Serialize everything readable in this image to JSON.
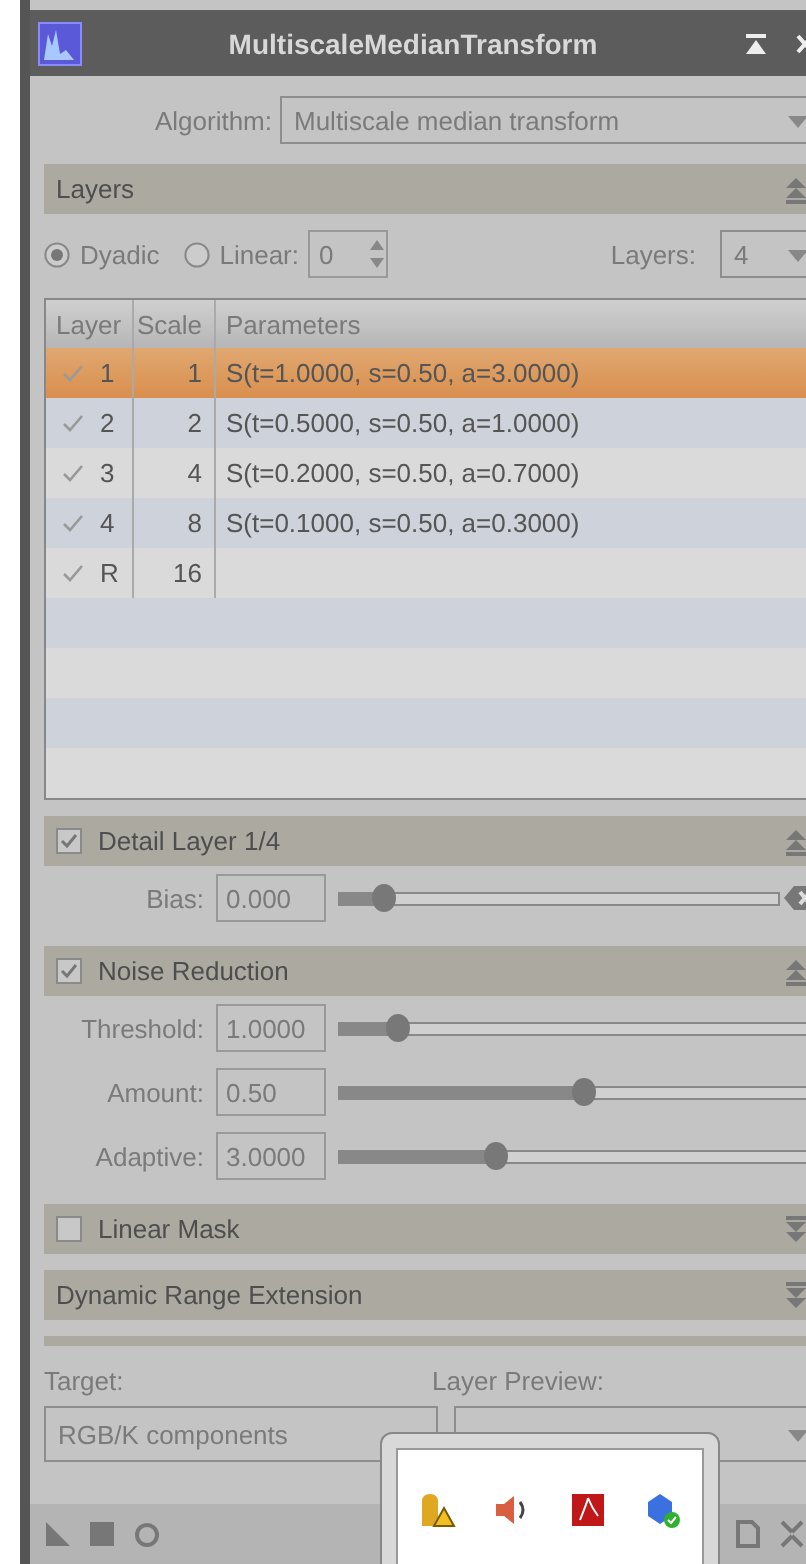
{
  "window": {
    "title": "MultiscaleMedianTransform"
  },
  "algorithm": {
    "label": "Algorithm:",
    "value": "Multiscale median transform"
  },
  "sections": [
    {
      "kind": "layers",
      "title": "Layers",
      "expanded": true,
      "scaling": [
        {
          "label": "Dyadic",
          "selected": true
        },
        {
          "label": "Linear:",
          "selected": false
        }
      ],
      "linear_value": "0",
      "count_label": "Layers:",
      "count_value": "4",
      "columns": [
        "Layer",
        "Scale",
        "Parameters"
      ],
      "rows": [
        {
          "layer": "1",
          "scale": "1",
          "parameters": "S(t=1.0000, s=0.50, a=3.0000)",
          "checked": true,
          "selected": true
        },
        {
          "layer": "2",
          "scale": "2",
          "parameters": "S(t=0.5000, s=0.50, a=1.0000)",
          "checked": true,
          "selected": false
        },
        {
          "layer": "3",
          "scale": "4",
          "parameters": "S(t=0.2000, s=0.50, a=0.7000)",
          "checked": true,
          "selected": false
        },
        {
          "layer": "4",
          "scale": "8",
          "parameters": "S(t=0.1000, s=0.50, a=0.3000)",
          "checked": true,
          "selected": false
        },
        {
          "layer": "R",
          "scale": "16",
          "parameters": "",
          "checked": true,
          "selected": false
        }
      ]
    },
    {
      "kind": "params",
      "title": "Detail Layer 1/4",
      "checked": true,
      "expanded": true,
      "params": [
        {
          "label": "Bias:",
          "value": "0.000",
          "level": 0.1,
          "reset": true
        }
      ]
    },
    {
      "kind": "params",
      "title": "Noise Reduction",
      "checked": true,
      "expanded": true,
      "params": [
        {
          "label": "Threshold:",
          "value": "1.0000",
          "level": 0.12
        },
        {
          "label": "Amount:",
          "value": "0.50",
          "level": 0.5
        },
        {
          "label": "Adaptive:",
          "value": "3.0000",
          "level": 0.32
        }
      ]
    },
    {
      "title": "Linear Mask",
      "checked": false,
      "expanded": false
    },
    {
      "title": "Dynamic Range Extension",
      "expanded": false
    }
  ],
  "target": {
    "label": "Target:",
    "value": "RGB/K components"
  },
  "layer_preview": {
    "label": "Layer Preview:"
  }
}
